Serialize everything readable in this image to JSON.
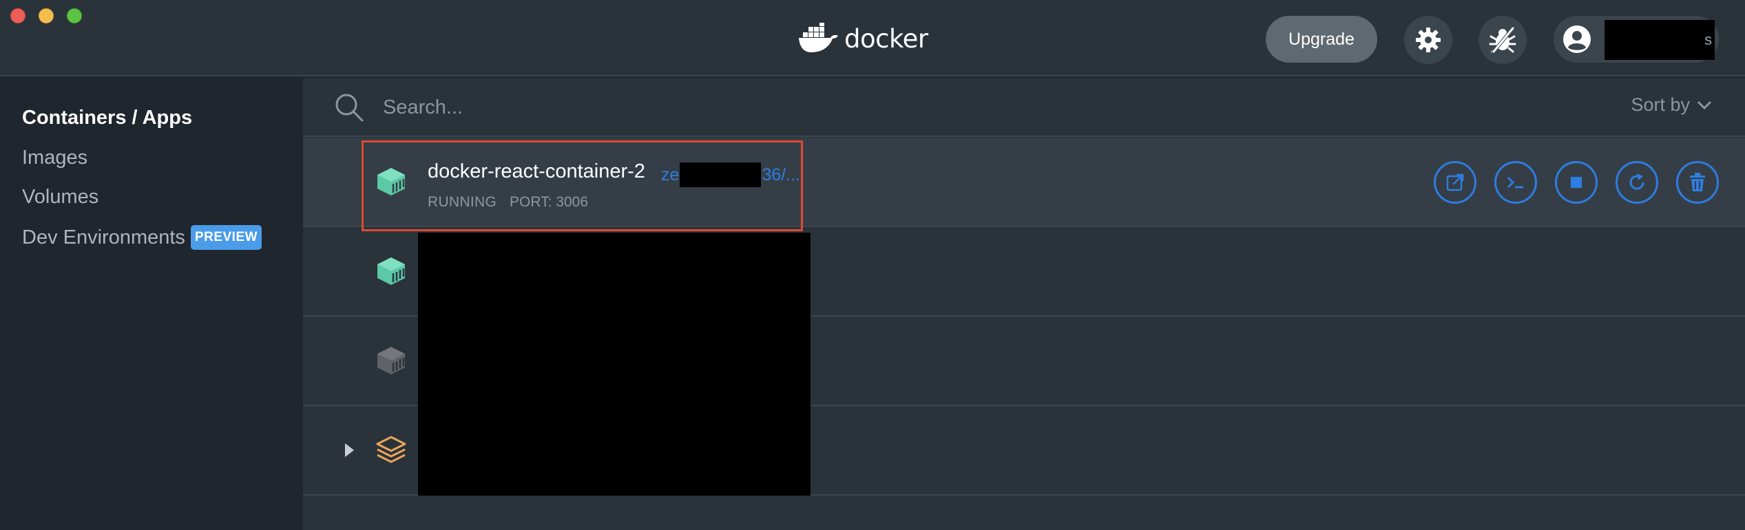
{
  "app": {
    "logo_text": "docker",
    "upgrade_label": "Upgrade",
    "account_name_suffix": "s"
  },
  "sidebar": {
    "items": [
      {
        "label": "Containers / Apps",
        "active": true
      },
      {
        "label": "Images",
        "active": false
      },
      {
        "label": "Volumes",
        "active": false
      },
      {
        "label": "Dev Environments",
        "active": false,
        "badge": "PREVIEW"
      }
    ]
  },
  "search": {
    "placeholder": "Search...",
    "sort_label": "Sort by"
  },
  "containers": [
    {
      "name": "docker-react-container-2",
      "link_prefix": "ze",
      "link_suffix": "36/...",
      "status": "RUNNING",
      "port": "PORT: 3006",
      "icon": "container-icon",
      "icon_color": "#5bc8a6",
      "selected": true
    },
    {
      "icon": "container-icon",
      "icon_color": "#5bc8a6"
    },
    {
      "icon": "container-icon",
      "icon_color": "#5f6367"
    },
    {
      "icon": "stack-icon",
      "icon_color": "#e9a55b",
      "expandable": true
    }
  ],
  "colors": {
    "accent": "#2e7de0",
    "running": "#5bc8a6",
    "stopped": "#5f6367",
    "compose": "#e9a55b",
    "highlight": "#dd4a34",
    "badge": "#4a9be8"
  }
}
